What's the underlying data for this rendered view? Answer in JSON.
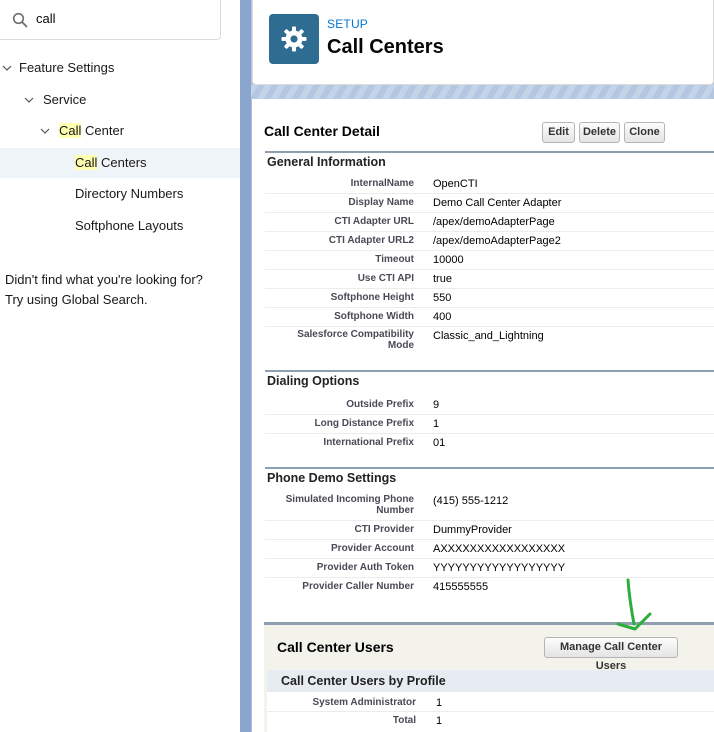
{
  "search": {
    "value": "call"
  },
  "tree": {
    "feature_settings": "Feature Settings",
    "service": "Service",
    "call_center_hl": "Call",
    "call_center_rest": " Center",
    "call_centers_hl": "Call",
    "call_centers_rest": " Centers",
    "directory_numbers": "Directory Numbers",
    "softphone_layouts": "Softphone Layouts"
  },
  "help": {
    "line1": "Didn't find what you're looking for?",
    "line2": "Try using Global Search."
  },
  "header": {
    "eyebrow": "SETUP",
    "title": "Call Centers"
  },
  "detail": {
    "title": "Call Center Detail",
    "buttons": {
      "edit": "Edit",
      "delete": "Delete",
      "clone": "Clone"
    }
  },
  "general": {
    "title": "General Information",
    "rows": [
      {
        "k": "InternalName",
        "v": "OpenCTI"
      },
      {
        "k": "Display Name",
        "v": "Demo Call Center Adapter"
      },
      {
        "k": "CTI Adapter URL",
        "v": "/apex/demoAdapterPage"
      },
      {
        "k": "CTI Adapter URL2",
        "v": "/apex/demoAdapterPage2"
      },
      {
        "k": "Timeout",
        "v": "10000"
      },
      {
        "k": "Use CTI API",
        "v": "true"
      },
      {
        "k": "Softphone Height",
        "v": "550"
      },
      {
        "k": "Softphone Width",
        "v": "400"
      },
      {
        "k1": "Salesforce Compatibility",
        "k2": "Mode",
        "v": "Classic_and_Lightning"
      }
    ]
  },
  "dialing": {
    "title": "Dialing Options",
    "rows": [
      {
        "k": "Outside Prefix",
        "v": "9"
      },
      {
        "k": "Long Distance Prefix",
        "v": "1"
      },
      {
        "k": "International Prefix",
        "v": "01"
      }
    ]
  },
  "phone_demo": {
    "title": "Phone Demo Settings",
    "rows": [
      {
        "k1": "Simulated Incoming Phone",
        "k2": "Number",
        "v": "(415) 555-1212"
      },
      {
        "k": "CTI Provider",
        "v": "DummyProvider"
      },
      {
        "k": "Provider Account",
        "v": "AXXXXXXXXXXXXXXXXX"
      },
      {
        "k": "Provider Auth Token",
        "v": "YYYYYYYYYYYYYYYYYY"
      },
      {
        "k": "Provider Caller Number",
        "v": "415555555"
      }
    ]
  },
  "users": {
    "title": "Call Center Users",
    "manage_button": "Manage Call Center Users",
    "subsection": "Call Center Users by Profile",
    "rows": [
      {
        "k": "System Administrator",
        "v": "1"
      },
      {
        "k": "Total",
        "v": "1"
      }
    ]
  },
  "colors": {
    "accent": "#0176d3",
    "setup_icon_bg": "#2f6c91",
    "highlight": "#ffffb0",
    "annotation_arrow": "#2dae3c"
  },
  "icons": [
    "search-icon",
    "chevron-down-icon",
    "gear-icon",
    "arrow-annotation-icon"
  ]
}
